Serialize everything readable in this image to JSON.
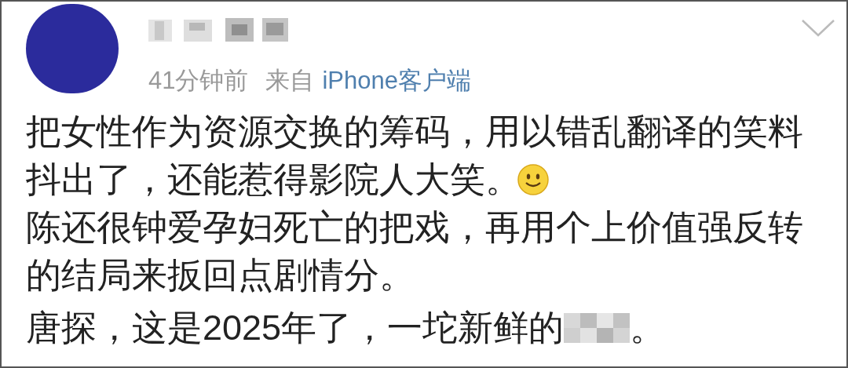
{
  "post": {
    "time": "41分钟前",
    "source_prefix": "来自",
    "source": "iPhone客户端",
    "lines": [
      {
        "text": "把女性作为资源交换的筹码，用以错乱翻译的笑料",
        "emoji": false
      },
      {
        "text": "抖出了，还能惹得影院人大笑。",
        "emoji": true
      },
      {
        "text": "陈还很钟爱孕妇死亡的把戏，再用个上价值强反转",
        "emoji": false
      },
      {
        "text": "的结局来扳回点剧情分。",
        "emoji": false
      }
    ],
    "last_line": {
      "before": "唐探，这是2025年了，一坨新鲜的",
      "after": "。"
    }
  }
}
